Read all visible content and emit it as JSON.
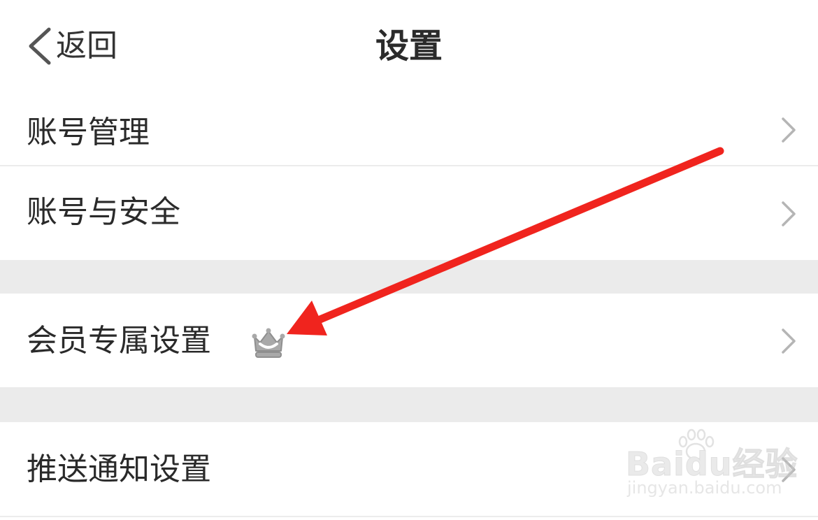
{
  "header": {
    "back_label": "返回",
    "title": "设置"
  },
  "settings": {
    "items": [
      {
        "label": "账号管理"
      },
      {
        "label": "账号与安全"
      },
      {
        "label": "会员专属设置",
        "badge_icon": "crown-icon"
      },
      {
        "label": "推送通知设置"
      }
    ]
  },
  "colors": {
    "annotation_arrow": "#f0241e",
    "section_gap": "#ebebeb",
    "chevron": "#b5b5b5"
  },
  "watermark": {
    "logo": "Baidu经验",
    "url": "jingyan.baidu.com"
  }
}
